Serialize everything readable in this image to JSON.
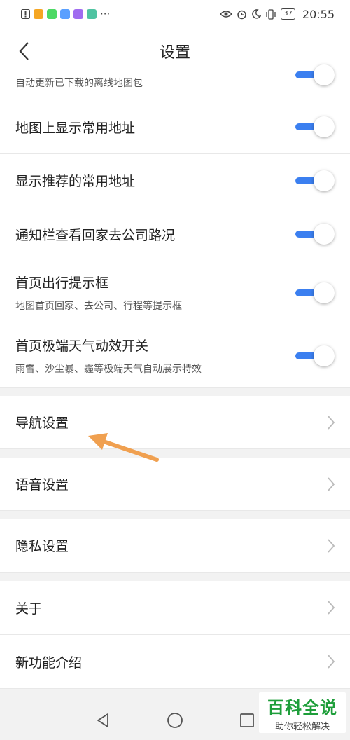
{
  "status_bar": {
    "time": "20:55",
    "battery": "37",
    "app_icon_colors": [
      "#f5a623",
      "#4cd964",
      "#5aa0ff",
      "#a06cf0",
      "#4fc3a1"
    ],
    "icons": [
      "alert-icon",
      "eye-icon",
      "alarm-icon",
      "moon-icon",
      "vibrate-icon",
      "battery-icon"
    ]
  },
  "header": {
    "title": "设置"
  },
  "settings": {
    "partial_sub": "自动更新已下载的离线地图包",
    "toggles": [
      {
        "title": "地图上显示常用地址",
        "sub": "",
        "on": true
      },
      {
        "title": "显示推荐的常用地址",
        "sub": "",
        "on": true
      },
      {
        "title": "通知栏查看回家去公司路况",
        "sub": "",
        "on": true
      },
      {
        "title": "首页出行提示框",
        "sub": "地图首页回家、去公司、行程等提示框",
        "on": true
      },
      {
        "title": "首页极端天气动效开关",
        "sub": "雨雪、沙尘暴、霾等极端天气自动展示特效",
        "on": true
      }
    ],
    "nav_items": [
      "导航设置",
      "语音设置",
      "隐私设置",
      "关于",
      "新功能介绍"
    ]
  },
  "watermark": {
    "title": "百科全说",
    "sub": "助你轻松解决"
  },
  "colors": {
    "toggle_on": "#3b7ff0",
    "arrow": "#f0a050",
    "watermark": "#1e9e3a"
  }
}
